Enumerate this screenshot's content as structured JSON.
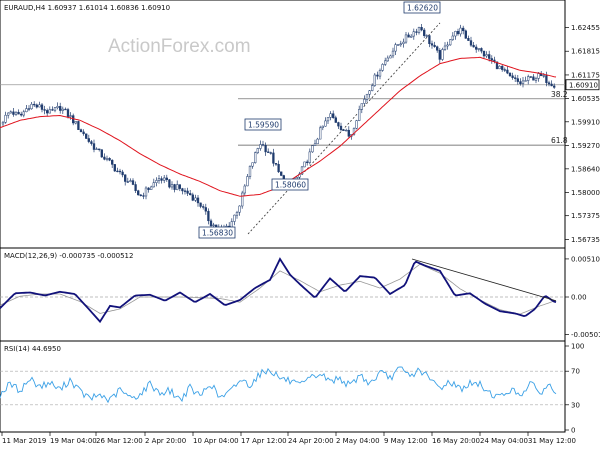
{
  "watermark": "ActionForex.com",
  "main": {
    "header": "EURAUD,H4  1.60937 1.61014 1.60836 1.60910",
    "price_labels": [
      "1.62455",
      "1.61815",
      "1.61175",
      "1.60535",
      "1.59910",
      "1.59270",
      "1.58640",
      "1.58000",
      "1.57375",
      "1.56735"
    ],
    "current_price": "1.60910",
    "levels": [
      {
        "label": "38.2",
        "value": 1.6053
      },
      {
        "label": "61.8",
        "value": 1.5928
      }
    ],
    "annotations": [
      "1.62620",
      "1.59590",
      "1.58060",
      "1.56830"
    ]
  },
  "macd": {
    "header": "MACD(12,26,9) -0.000735 -0.000512",
    "labels": [
      "0.005108",
      "0.00",
      "-0.005019"
    ]
  },
  "rsi": {
    "header": "RSI(14) 44.6950",
    "labels": [
      "100",
      "70",
      "30",
      "0"
    ]
  },
  "time_labels": [
    "11 Mar 2019",
    "19 Mar 04:00",
    "26 Mar 12:00",
    "2 Apr 20:00",
    "10 Apr 04:00",
    "17 Apr 12:00",
    "24 Apr 20:00",
    "2 May 04:00",
    "9 May 12:00",
    "16 May 20:00",
    "24 May 04:00",
    "31 May 12:00"
  ],
  "chart_data": [
    {
      "type": "candlestick",
      "title": "EURAUD,H4",
      "ylim": [
        1.5653,
        1.6282
      ],
      "series": [
        {
          "name": "price",
          "x": [
            0,
            10,
            20,
            30,
            40,
            50,
            60,
            70,
            80,
            90,
            100,
            110,
            120,
            130,
            140,
            150,
            160,
            170,
            180,
            190,
            200,
            205,
            210,
            220,
            230,
            240,
            250,
            260,
            270,
            280,
            290,
            300,
            310,
            320,
            330,
            340,
            350,
            360,
            370,
            380,
            390,
            400,
            410,
            420,
            430,
            440,
            450,
            460,
            470,
            480,
            490,
            500,
            510,
            520,
            530,
            540,
            550,
            555
          ],
          "values": [
            1.5985,
            1.602,
            1.6005,
            1.6038,
            1.603,
            1.6015,
            1.603,
            1.6005,
            1.597,
            1.5935,
            1.5905,
            1.588,
            1.585,
            1.5825,
            1.579,
            1.5815,
            1.584,
            1.582,
            1.581,
            1.5795,
            1.577,
            1.5745,
            1.572,
            1.5698,
            1.5712,
            1.577,
            1.5865,
            1.5935,
            1.5905,
            1.5845,
            1.5815,
            1.585,
            1.5905,
            1.5965,
            1.601,
            1.598,
            1.595,
            1.603,
            1.6085,
            1.6135,
            1.6175,
            1.6205,
            1.6225,
            1.6248,
            1.6205,
            1.6165,
            1.6218,
            1.624,
            1.6205,
            1.6182,
            1.616,
            1.6135,
            1.611,
            1.6095,
            1.6108,
            1.6115,
            1.6098,
            1.6091
          ]
        },
        {
          "name": "MA",
          "x": [
            0,
            20,
            40,
            60,
            80,
            100,
            120,
            140,
            160,
            180,
            200,
            220,
            240,
            260,
            280,
            300,
            320,
            340,
            360,
            380,
            400,
            420,
            440,
            460,
            480,
            500,
            520,
            540,
            555
          ],
          "values": [
            1.5975,
            1.5995,
            1.6005,
            1.6008,
            1.5995,
            1.597,
            1.594,
            1.5905,
            1.5875,
            1.585,
            1.583,
            1.5805,
            1.579,
            1.5795,
            1.5815,
            1.585,
            1.5885,
            1.5925,
            1.5975,
            1.6025,
            1.6075,
            1.6115,
            1.6148,
            1.6162,
            1.6165,
            1.6148,
            1.613,
            1.6122,
            1.6112
          ]
        }
      ]
    },
    {
      "type": "line",
      "title": "MACD(12,26,9)",
      "ylim": [
        -0.0055,
        0.0055
      ],
      "series": [
        {
          "name": "MACD",
          "x": [
            0,
            15,
            30,
            45,
            60,
            75,
            90,
            100,
            110,
            120,
            135,
            150,
            165,
            180,
            195,
            210,
            225,
            240,
            255,
            270,
            280,
            290,
            300,
            315,
            330,
            345,
            360,
            375,
            390,
            405,
            415,
            425,
            440,
            455,
            470,
            485,
            500,
            515,
            525,
            535,
            545,
            555
          ],
          "values": [
            -0.0015,
            0.0005,
            0.0006,
            0.0002,
            0.0007,
            0.0004,
            -0.0018,
            -0.0033,
            -0.0012,
            -0.0014,
            0.0002,
            0.0003,
            -0.0005,
            0.0006,
            -0.0007,
            0.0004,
            -0.0011,
            -0.0004,
            0.0012,
            0.0023,
            0.0051,
            0.003,
            0.0017,
            -0.0001,
            0.0025,
            0.0007,
            0.0028,
            0.0026,
            0.0004,
            0.0016,
            0.0048,
            0.0042,
            0.0035,
            0.0002,
            0.0005,
            -0.0009,
            -0.0019,
            -0.0022,
            -0.0026,
            -0.0016,
            0.0002,
            -0.0007
          ]
        },
        {
          "name": "Signal",
          "x": [
            0,
            20,
            40,
            60,
            80,
            100,
            120,
            140,
            160,
            180,
            200,
            220,
            240,
            260,
            280,
            300,
            320,
            340,
            360,
            380,
            400,
            420,
            440,
            460,
            480,
            500,
            520,
            540,
            555
          ],
          "values": [
            -0.0011,
            0.0001,
            0.0004,
            0.0004,
            -0.0006,
            -0.0022,
            -0.0016,
            0.0,
            0.0,
            0.0,
            -0.0001,
            -0.0002,
            -0.0007,
            0.0012,
            0.0035,
            0.0022,
            0.0007,
            0.0016,
            0.0021,
            0.0012,
            0.0024,
            0.0044,
            0.0032,
            0.0011,
            -0.0004,
            -0.0017,
            -0.0023,
            -0.0012,
            -0.0005
          ]
        }
      ]
    },
    {
      "type": "line",
      "title": "RSI(14)",
      "ylim": [
        0,
        100
      ],
      "series": [
        {
          "name": "RSI",
          "x": [
            0,
            10,
            20,
            30,
            40,
            50,
            60,
            70,
            80,
            90,
            100,
            110,
            120,
            130,
            140,
            150,
            160,
            170,
            180,
            190,
            200,
            210,
            220,
            230,
            240,
            250,
            260,
            270,
            280,
            290,
            300,
            310,
            320,
            330,
            340,
            350,
            360,
            370,
            380,
            390,
            400,
            410,
            420,
            430,
            440,
            450,
            460,
            470,
            480,
            490,
            500,
            510,
            520,
            530,
            540,
            550,
            555
          ],
          "values": [
            42,
            55,
            47,
            61,
            52,
            56,
            48,
            60,
            46,
            37,
            42,
            35,
            48,
            38,
            42,
            55,
            44,
            47,
            36,
            50,
            40,
            56,
            38,
            45,
            60,
            54,
            67,
            72,
            62,
            58,
            52,
            61,
            67,
            58,
            62,
            52,
            66,
            55,
            68,
            62,
            73,
            64,
            72,
            60,
            50,
            58,
            49,
            55,
            54,
            44,
            39,
            48,
            42,
            55,
            45,
            53,
            45
          ]
        }
      ]
    }
  ]
}
